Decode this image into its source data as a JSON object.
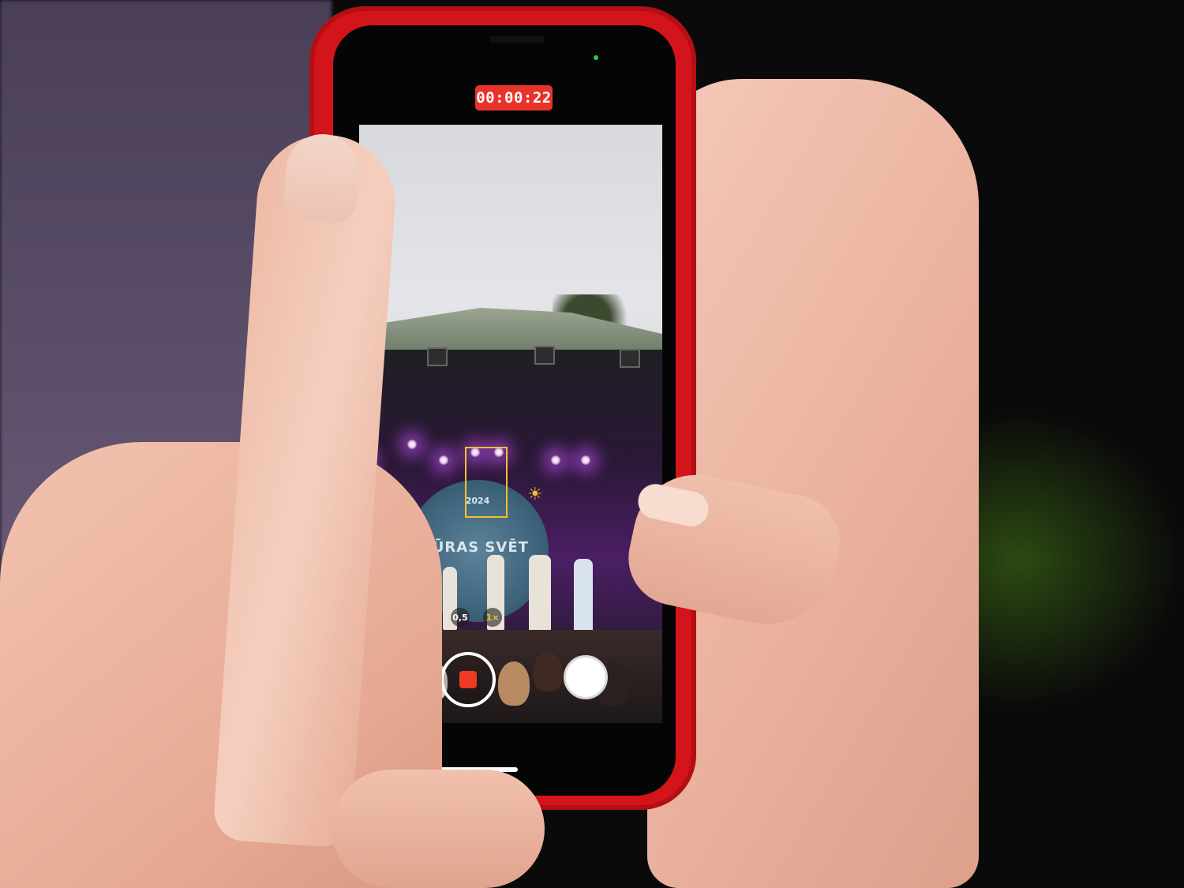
{
  "recording": {
    "timer": "00:00:22"
  },
  "stage_banner": {
    "title": "JŪRAS SVĒT",
    "year": "2024"
  },
  "zoom": {
    "wide": "0,5",
    "standard": "1×"
  },
  "colors": {
    "phone_case": "#d3141a",
    "timer_bg": "#e8332a",
    "focus_box": "#f2c12e",
    "stop_button": "#ee3a22"
  },
  "icons": {
    "exposure": "sun-icon"
  }
}
